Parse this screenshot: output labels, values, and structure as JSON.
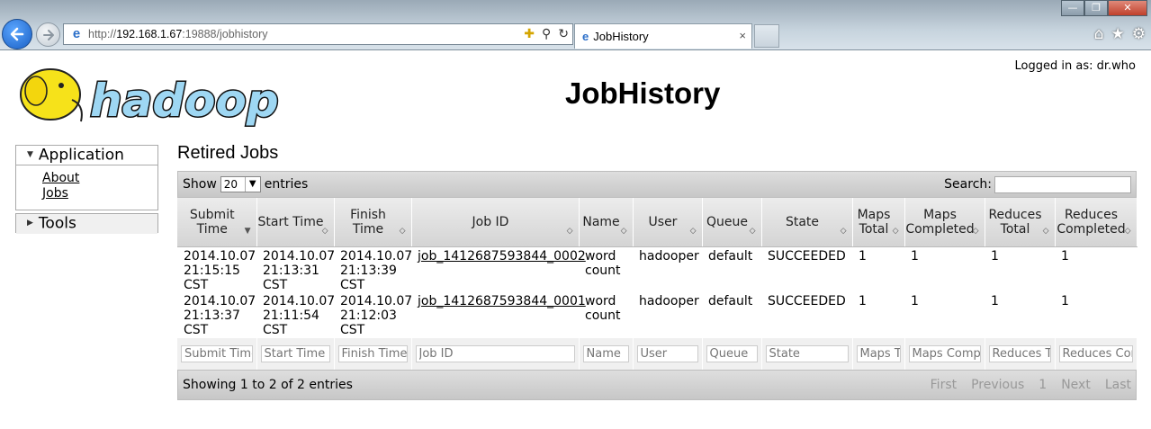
{
  "browser": {
    "url_protocol": "http://",
    "url_host": "192.168.1.67",
    "url_path": ":19888/jobhistory",
    "tab_title": "JobHistory",
    "tab_close": "×",
    "min_symbol": "—",
    "max_symbol": "❐",
    "close_symbol": "✕"
  },
  "header": {
    "logo_text": "hadoop",
    "logged_in": "Logged in as: dr.who",
    "title": "JobHistory"
  },
  "sidebar": {
    "application": {
      "label": "Application",
      "items": [
        "About",
        "Jobs"
      ]
    },
    "tools": {
      "label": "Tools"
    }
  },
  "main": {
    "section_title": "Retired Jobs",
    "show_label": "Show",
    "show_value": "20",
    "entries_label": "entries",
    "search_label": "Search:",
    "columns": [
      "Submit Time",
      "Start Time",
      "Finish Time",
      "Job ID",
      "Name",
      "User",
      "Queue",
      "State",
      "Maps Total",
      "Maps Completed",
      "Reduces Total",
      "Reduces Completed"
    ],
    "rows": [
      [
        "2014.10.07 21:15:15 CST",
        "2014.10.07 21:13:31 CST",
        "2014.10.07 21:13:39 CST",
        "job_1412687593844_0002",
        "word count",
        "hadooper",
        "default",
        "SUCCEEDED",
        "1",
        "1",
        "1",
        "1"
      ],
      [
        "2014.10.07 21:13:37 CST",
        "2014.10.07 21:11:54 CST",
        "2014.10.07 21:12:03 CST",
        "job_1412687593844_0001",
        "word count",
        "hadooper",
        "default",
        "SUCCEEDED",
        "1",
        "1",
        "1",
        "1"
      ]
    ],
    "filters": [
      "Submit Time",
      "Start Time",
      "Finish Time",
      "Job ID",
      "Name",
      "User",
      "Queue",
      "State",
      "Maps T",
      "Maps Comple",
      "Reduces Te",
      "Reduces Cor"
    ],
    "info": "Showing 1 to 2 of 2 entries",
    "pager": {
      "first": "First",
      "previous": "Previous",
      "page": "1",
      "next": "Next",
      "last": "Last"
    }
  }
}
